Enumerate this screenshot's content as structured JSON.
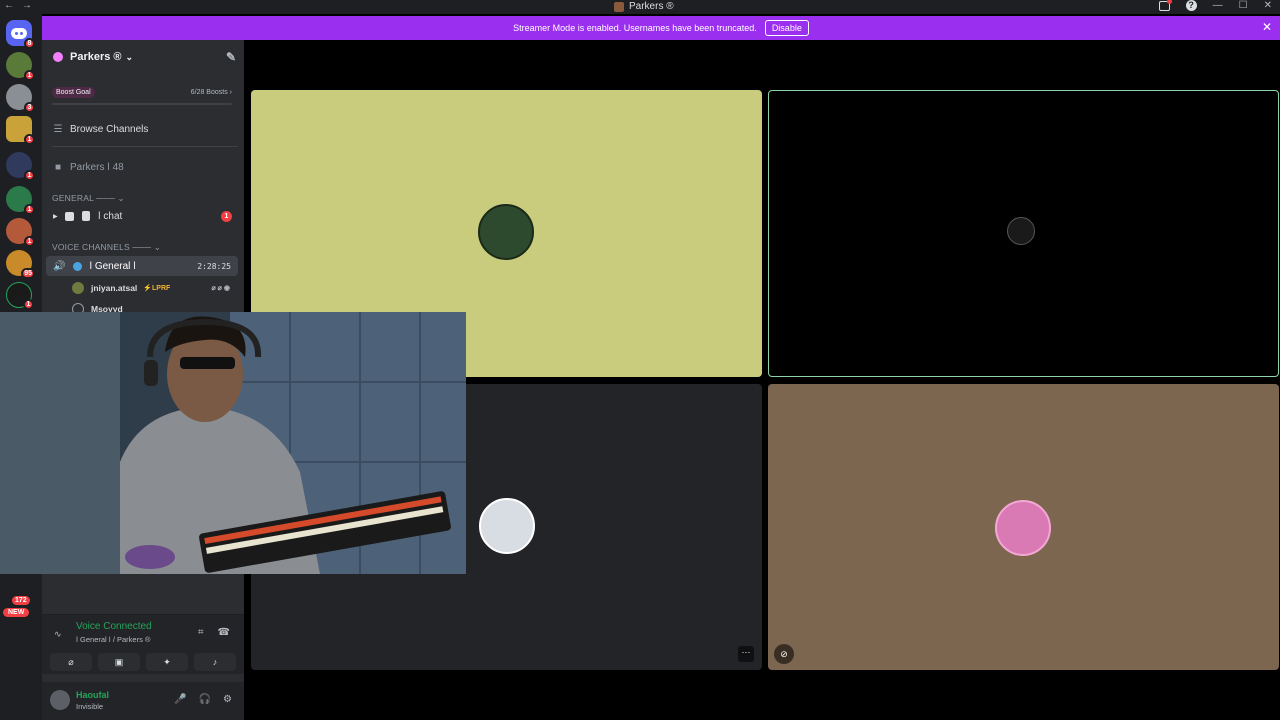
{
  "window": {
    "title": "Parkers ®",
    "nav_back": "←",
    "nav_fwd": "→",
    "help": "?",
    "minimize": "—",
    "maximize": "☐",
    "close": "✕"
  },
  "guilds": [
    {
      "badge": "8",
      "color": "#5865f2"
    },
    {
      "badge": "1",
      "color": "#5a7a3a"
    },
    {
      "badge": "3",
      "color": "#8a8f96"
    },
    {
      "badge": "1",
      "color": "#c9a23a"
    },
    {
      "badge": "1",
      "color": "#2f3a5c"
    },
    {
      "badge": "1",
      "color": "#2a7a4a"
    },
    {
      "badge": "1",
      "color": "#b45a3a"
    },
    {
      "badge": "95",
      "color": "#c98a2a"
    },
    {
      "badge": "1",
      "color": "#1a1a1a"
    }
  ],
  "new_pill": {
    "count": "172",
    "label": "NEW"
  },
  "banner": {
    "text": "Streamer Mode is enabled. Usernames have been truncated.",
    "button": "Disable",
    "close": "✕"
  },
  "sidebar": {
    "server_name": "Parkers ®",
    "chevron": "⌄",
    "boost_goal": "Boost Goal",
    "boost_count": "6/28 Boosts",
    "boost_arrow": "›",
    "browse_channels": "Browse Channels",
    "member_channel": "Parkers ǀ 48",
    "cat_general": "GENERAL",
    "chat_channel": "ǀ chat",
    "chat_badge": "1",
    "cat_voice": "VOICE CHANNELS",
    "voice_channel": "ǀ General ǀ",
    "voice_time": "2:28:25",
    "users": [
      {
        "name": "jniyan.atsal",
        "tag": "⚡LPRF"
      },
      {
        "name": "Msoyyd",
        "tag": ""
      }
    ]
  },
  "voice": {
    "status": "Voice Connected",
    "sub": "ǀ General ǀ / Parkers ®",
    "btn_camera": "⌀",
    "btn_screen": "▣",
    "btn_activity": "✦",
    "btn_sound": "♪"
  },
  "user": {
    "name": "Haoufal",
    "status": "Invisible"
  },
  "tiles": [
    {
      "bg": "#c8cc7c",
      "avatar_color": "#2e4a2e"
    },
    {
      "bg": "#000000",
      "avatar_color": "#1a1a1a"
    },
    {
      "bg": "#232428",
      "avatar_color": "#d8dde3"
    },
    {
      "bg": "#7d6650",
      "avatar_color": "#d97ab4"
    }
  ],
  "tile_more": "···",
  "colors": {
    "accent": "#5865f2",
    "banner": "#9b2ff0",
    "online": "#23a559",
    "danger": "#f23f43"
  }
}
